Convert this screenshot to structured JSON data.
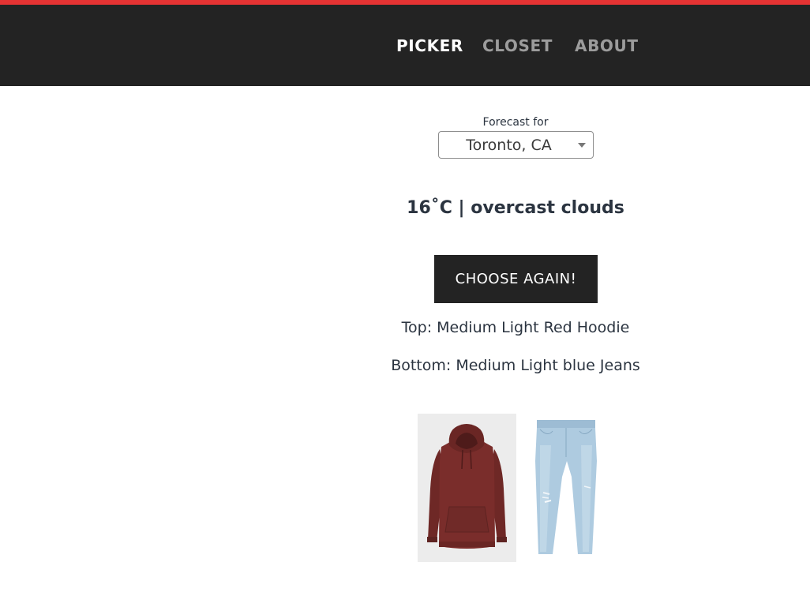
{
  "nav": {
    "items": [
      {
        "label": "PICKER",
        "active": true
      },
      {
        "label": "CLOSET",
        "active": false
      },
      {
        "label": "ABOUT",
        "active": false
      }
    ]
  },
  "forecast": {
    "label": "Forecast for",
    "location": "Toronto, CA"
  },
  "weather": {
    "summary": "16˚C | overcast clouds"
  },
  "actions": {
    "choose_again": "CHOOSE AGAIN!"
  },
  "outfit": {
    "top": "Top: Medium Light Red Hoodie",
    "bottom": "Bottom: Medium Light blue Jeans"
  },
  "colors": {
    "accent": "#e53333",
    "navbar": "#232323",
    "nav_active": "#ffffff",
    "nav_inactive": "#9c9c9c",
    "hoodie": "#7a2d2b",
    "jeans": "#aecbe0"
  },
  "images": {
    "top_icon": "red-hoodie-image",
    "bottom_icon": "light-blue-jeans-image"
  }
}
